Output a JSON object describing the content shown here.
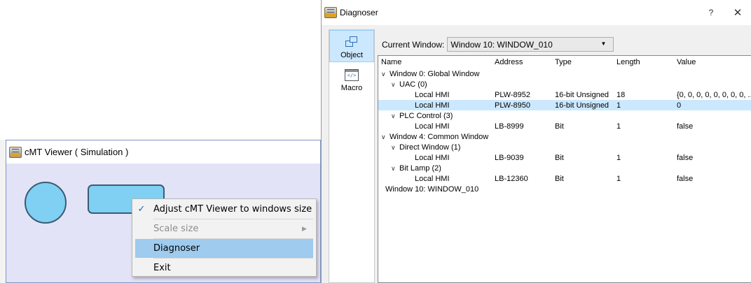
{
  "viewer": {
    "title": "cMT Viewer ( Simulation )"
  },
  "context_menu": {
    "items": [
      {
        "label": "Adjust cMT Viewer to windows size",
        "checked": true
      },
      {
        "label": "Scale size",
        "disabled": true,
        "has_submenu": true
      },
      {
        "label": "Diagnoser",
        "highlighted": true
      },
      {
        "label": "Exit"
      }
    ]
  },
  "diagnoser": {
    "title": "Diagnoser",
    "help_label": "?",
    "close_label": "✕",
    "side_tabs": [
      {
        "label": "Object",
        "icon": "object-icon",
        "active": true
      },
      {
        "label": "Macro",
        "icon": "macro-icon",
        "icon_text": "</>"
      }
    ],
    "current_window_label": "Current Window:",
    "current_window_value": "Window 10: WINDOW_010",
    "columns": [
      "Name",
      "Address",
      "Type",
      "Length",
      "Value"
    ],
    "rows": [
      {
        "name": "Window 0: Global Window",
        "address": "",
        "type": "",
        "length": "",
        "value": ""
      },
      {
        "name": "UAC (0)",
        "address": "",
        "type": "",
        "length": "",
        "value": ""
      },
      {
        "name": "Local HMI",
        "address": "PLW-8952",
        "type": "16-bit Unsigned",
        "length": "18",
        "value": "{0, 0, 0, 0, 0, 0, 0, 0, ..."
      },
      {
        "name": "Local HMI",
        "address": "PLW-8950",
        "type": "16-bit Unsigned",
        "length": "1",
        "value": "0"
      },
      {
        "name": "PLC Control (3)",
        "address": "",
        "type": "",
        "length": "",
        "value": ""
      },
      {
        "name": "Local HMI",
        "address": "LB-8999",
        "type": "Bit",
        "length": "1",
        "value": "false"
      },
      {
        "name": "Window 4: Common Window",
        "address": "",
        "type": "",
        "length": "",
        "value": ""
      },
      {
        "name": "Direct Window (1)",
        "address": "",
        "type": "",
        "length": "",
        "value": ""
      },
      {
        "name": "Local HMI",
        "address": "LB-9039",
        "type": "Bit",
        "length": "1",
        "value": "false"
      },
      {
        "name": "Bit Lamp (2)",
        "address": "",
        "type": "",
        "length": "",
        "value": ""
      },
      {
        "name": "Local HMI",
        "address": "LB-12360",
        "type": "Bit",
        "length": "1",
        "value": "false"
      },
      {
        "name": "Window 10: WINDOW_010",
        "address": "",
        "type": "",
        "length": "",
        "value": ""
      }
    ],
    "selected_row": 3
  },
  "colors": {
    "canvas_bg": "#e3e3f7",
    "shape_fill": "#7fd0f2",
    "menu_highlight": "#9ecbee",
    "selection": "#cce8ff"
  }
}
